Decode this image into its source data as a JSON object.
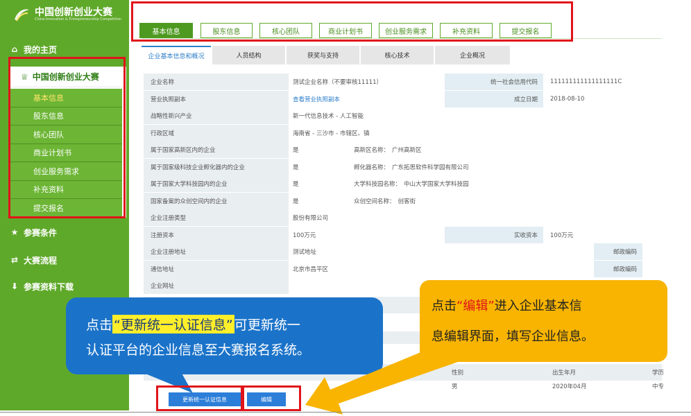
{
  "logo": {
    "title": "中国创新创业大赛",
    "subtitle": "China Innovation & Entrepreneurship Competition"
  },
  "sidebar": {
    "home_label": "我的主页",
    "contest_label": "中国创新创业大赛",
    "items": [
      {
        "label": "基本信息",
        "active": true
      },
      {
        "label": "股东信息",
        "active": false
      },
      {
        "label": "核心团队",
        "active": false
      },
      {
        "label": "商业计划书",
        "active": false
      },
      {
        "label": "创业服务需求",
        "active": false
      },
      {
        "label": "补充资料",
        "active": false
      },
      {
        "label": "提交报名",
        "active": false
      }
    ],
    "bottom_items": [
      {
        "label": "参赛条件",
        "icon": "star-icon"
      },
      {
        "label": "大赛流程",
        "icon": "flow-icon"
      },
      {
        "label": "参赛资料下载",
        "icon": "download-icon"
      }
    ]
  },
  "steps": [
    "基本信息",
    "股东信息",
    "核心团队",
    "商业计划书",
    "创业服务需求",
    "补充资料",
    "提交报名"
  ],
  "subtabs": [
    "企业基本信息和概况",
    "人员结构",
    "获奖与支持",
    "核心技术",
    "企业概况"
  ],
  "info": {
    "company_name_label": "企业名称",
    "company_name": "测试企业名称（不要审核11111）",
    "credit_code_label": "统一社会信用代码",
    "credit_code": "111111111111111111C",
    "license_label": "营业执照副本",
    "license_link": "查看营业执照副本",
    "found_date_label": "成立日期",
    "found_date": "2018-08-10",
    "industry_label": "战略性新兴产业",
    "industry": "新一代信息技术 - 人工智能",
    "region_label": "行政区域",
    "region": "海南省 - 三沙市 - 市辖区、镇",
    "hitech_zone_label": "属于国家高新区内的企业",
    "hitech_zone": "是",
    "hitech_zone_name_label": "高新区名称：",
    "hitech_zone_name": "广州高新区",
    "incubator_label": "属于国家级科技企业孵化器内的企业",
    "incubator": "是",
    "incubator_name_label": "孵化器名称：",
    "incubator_name": "广东拓思软件科学园有限公司",
    "univ_park_label": "属于国家大学科技园内的企业",
    "univ_park": "是",
    "univ_park_name_label": "大学科技园名称：",
    "univ_park_name": "中山大学国家大学科技园",
    "maker_space_label": "国家备案的众创空间内的企业",
    "maker_space": "是",
    "maker_space_name_label": "众创空间名称：",
    "maker_space_name": "创客街",
    "reg_type_label": "企业注册类型",
    "reg_type": "股份有限公司",
    "reg_capital_label": "注册资本",
    "reg_capital": "100万元",
    "paid_capital_label": "实收资本",
    "paid_capital": "100万元",
    "reg_address_label": "企业注册地址",
    "reg_address": "测试地址",
    "postcode_label": "邮政编码",
    "mail_address_label": "通信地址",
    "mail_address": "北京市昌平区",
    "website_label": "企业网址"
  },
  "lower_table": {
    "gender_label": "性别",
    "birth_label": "出生年月",
    "edu_label": "学历",
    "gender": "男",
    "birth": "2020年04月",
    "edu": "中专"
  },
  "callouts": {
    "blue_prefix": "点击",
    "blue_highlight": "“更新统一认证信息”",
    "blue_suffix": "可更新统一",
    "blue_line2": "认证平台的企业信息至大赛报名系统。",
    "yellow_prefix": "点击",
    "yellow_red": "“编辑”",
    "yellow_suffix": "进入企业基本信",
    "yellow_line2": "息编辑界面，填写企业信息。"
  },
  "buttons": {
    "update": "更新统一认证信息",
    "edit": "编辑"
  },
  "colors": {
    "sidebar": "#5fa92a",
    "accent_blue": "#2c7ed8",
    "callout_blue": "#1b73c9",
    "callout_yellow": "#f8b400",
    "highlight_red": "#e0141a"
  }
}
